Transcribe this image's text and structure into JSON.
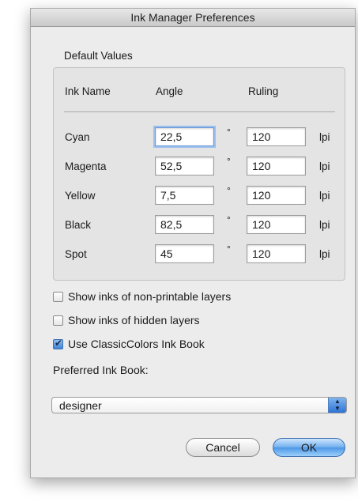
{
  "window": {
    "title": "Ink Manager Preferences"
  },
  "defaults": {
    "group_label": "Default Values",
    "headers": {
      "ink_name": "Ink Name",
      "angle": "Angle",
      "ruling": "Ruling"
    },
    "degree_symbol": "°",
    "unit": "lpi",
    "rows": [
      {
        "name": "Cyan",
        "angle": "22,5",
        "ruling": "120"
      },
      {
        "name": "Magenta",
        "angle": "52,5",
        "ruling": "120"
      },
      {
        "name": "Yellow",
        "angle": "7,5",
        "ruling": "120"
      },
      {
        "name": "Black",
        "angle": "82,5",
        "ruling": "120"
      },
      {
        "name": "Spot",
        "angle": "45",
        "ruling": "120"
      }
    ]
  },
  "options": [
    {
      "label": "Show inks of non-printable layers",
      "checked": false
    },
    {
      "label": "Show inks of hidden layers",
      "checked": false
    },
    {
      "label": "Use ClassicColors Ink Book",
      "checked": true
    }
  ],
  "ink_book": {
    "label": "Preferred Ink Book:",
    "selected": "designer"
  },
  "buttons": {
    "cancel": "Cancel",
    "ok": "OK"
  },
  "colors": {
    "accent": "#3e84d8",
    "focus_ring": "#9cc0ee"
  }
}
